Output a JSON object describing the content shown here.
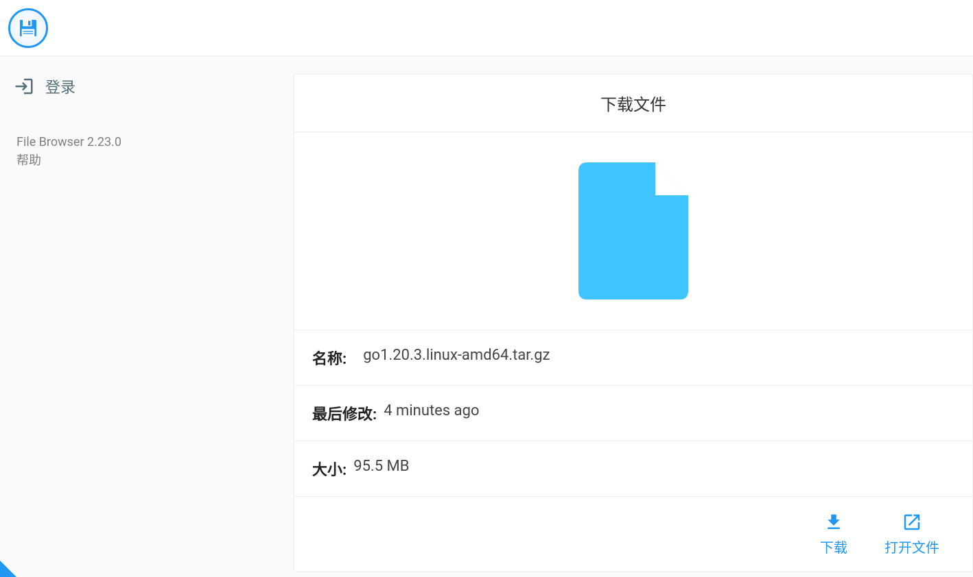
{
  "sidebar": {
    "login_label": "登录",
    "version": "File Browser 2.23.0",
    "help": "帮助"
  },
  "card": {
    "title": "下载文件",
    "name_label": "名称:",
    "name_value": "go1.20.3.linux-amd64.tar.gz",
    "modified_label": "最后修改:",
    "modified_value": "4 minutes ago",
    "size_label": "大小:",
    "size_value": "95.5 MB"
  },
  "actions": {
    "download_label": "下载",
    "open_label": "打开文件"
  }
}
